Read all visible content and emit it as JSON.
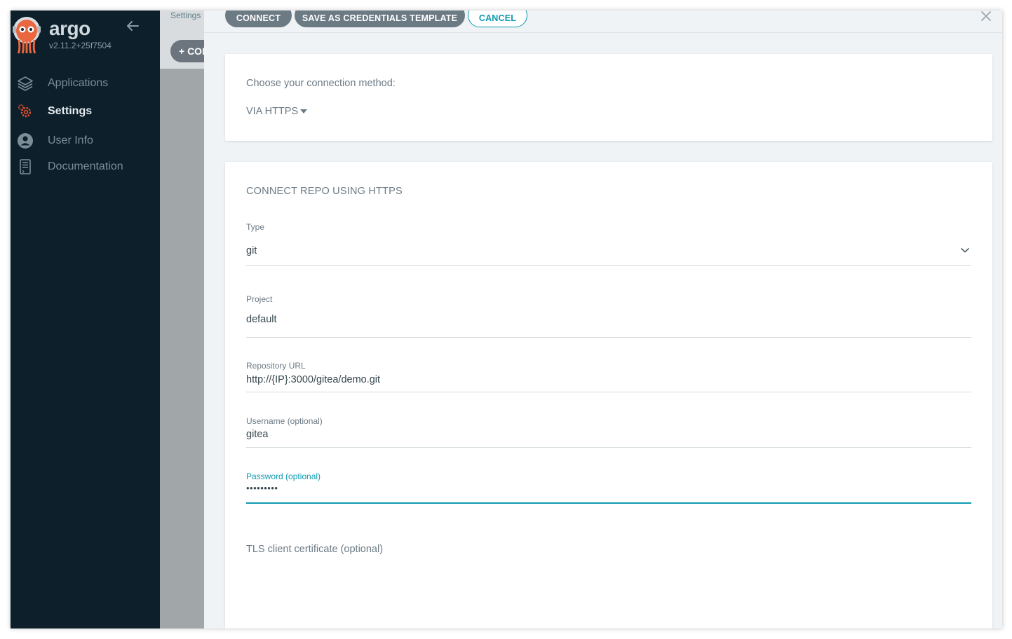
{
  "sidebar": {
    "brand": "argo",
    "version": "v2.11.2+25f7504",
    "items": [
      {
        "label": "Applications",
        "icon": "layers-icon",
        "active": false
      },
      {
        "label": "Settings",
        "icon": "gears-icon",
        "active": true
      },
      {
        "label": "User Info",
        "icon": "user-circle-icon",
        "active": false
      },
      {
        "label": "Documentation",
        "icon": "book-icon",
        "active": false
      }
    ]
  },
  "underlay": {
    "breadcrumb": "Settings",
    "button_label": "+ CONNECT REPO"
  },
  "panel": {
    "buttons": {
      "connect": "CONNECT",
      "save_template": "SAVE AS CREDENTIALS TEMPLATE",
      "cancel": "CANCEL"
    },
    "method": {
      "label": "Choose your connection method:",
      "value": "VIA HTTPS"
    },
    "form": {
      "title": "CONNECT REPO USING HTTPS",
      "type": {
        "label": "Type",
        "value": "git"
      },
      "project": {
        "label": "Project",
        "value": "default"
      },
      "repo_url": {
        "label": "Repository URL",
        "value": "http://{IP}:3000/gitea/demo.git"
      },
      "username": {
        "label": "Username (optional)",
        "value": "gitea"
      },
      "password": {
        "label": "Password (optional)",
        "value": "•••••••••"
      },
      "tls_label": "TLS client certificate (optional)"
    }
  },
  "colors": {
    "sidebar_bg": "#0c1f2a",
    "accent": "#0d9ab0",
    "button_dark": "#6c7a84",
    "settings_icon": "#e2502f"
  }
}
